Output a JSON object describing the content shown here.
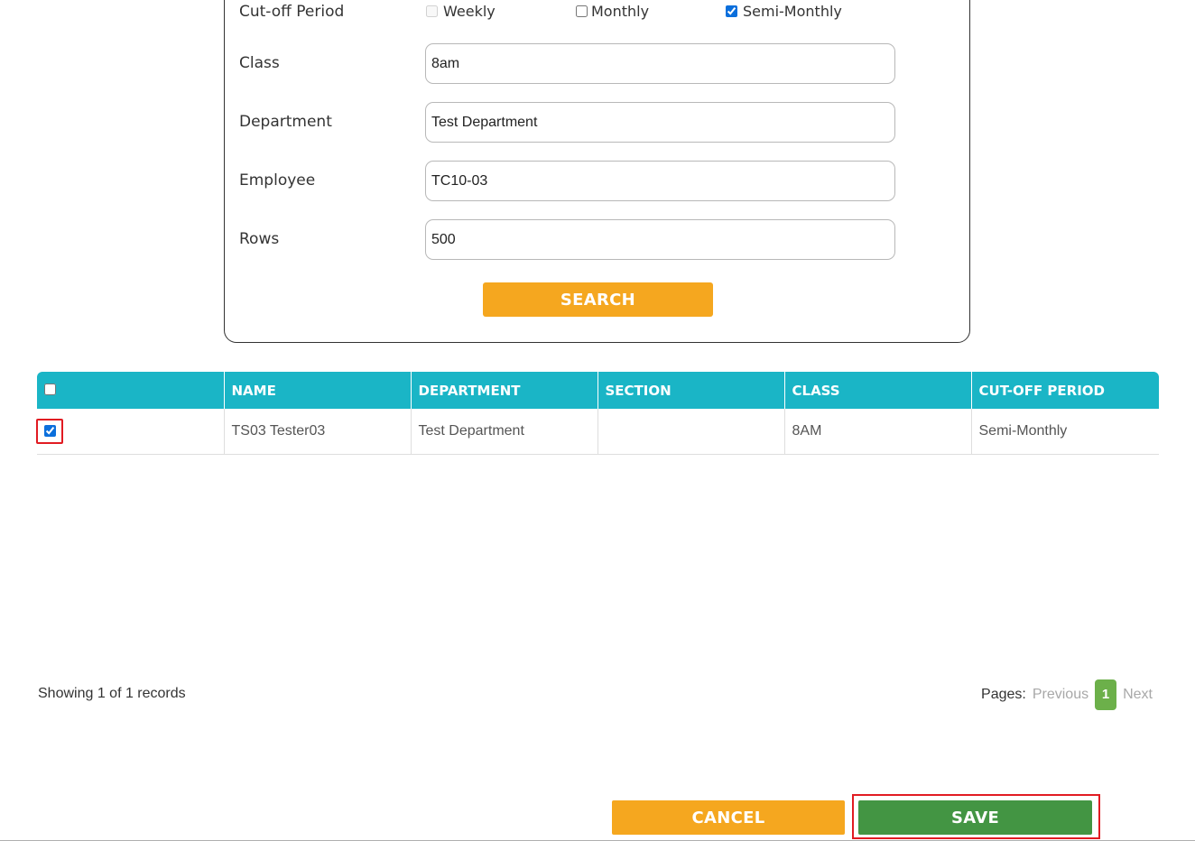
{
  "form": {
    "cutoff_label": "Cut-off Period",
    "cutoff_options": [
      {
        "label": "Weekly",
        "checked": false,
        "disabled": true
      },
      {
        "label": "Monthly",
        "checked": false,
        "disabled": false
      },
      {
        "label": "Semi-Monthly",
        "checked": true,
        "disabled": false
      }
    ],
    "class_label": "Class",
    "class_value": "8am",
    "department_label": "Department",
    "department_value": "Test Department",
    "employee_label": "Employee",
    "employee_value": "TC10-03",
    "rows_label": "Rows",
    "rows_value": "500",
    "search_button": "SEARCH"
  },
  "table": {
    "columns": [
      "NAME",
      "DEPARTMENT",
      "SECTION",
      "CLASS",
      "CUT-OFF PERIOD"
    ],
    "select_all_checked": false,
    "rows": [
      {
        "checked": true,
        "name": "TS03 Tester03",
        "department": "Test Department",
        "section": "",
        "class": "8AM",
        "cutoff": "Semi-Monthly"
      }
    ]
  },
  "footer": {
    "showing_text": "Showing 1 of 1 records",
    "pages_label": "Pages:",
    "previous": "Previous",
    "current_page": "1",
    "next": "Next"
  },
  "actions": {
    "cancel": "CANCEL",
    "save": "SAVE"
  },
  "colors": {
    "table_header": "#1ab5c6",
    "search_button": "#f5a71f",
    "cancel_button": "#f5a71f",
    "save_button": "#439543",
    "highlight": "#e11b22",
    "current_page": "#6cb04a"
  }
}
